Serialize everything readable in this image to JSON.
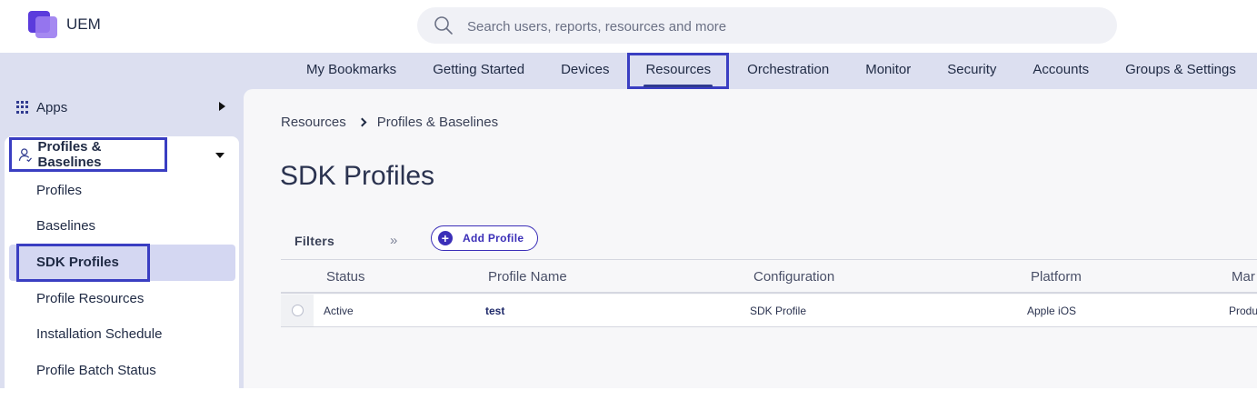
{
  "app": {
    "name": "UEM",
    "logo_icon": "uem-logo-icon",
    "brand_color": "#5b3bdc"
  },
  "search": {
    "placeholder": "Search users, reports, resources and more"
  },
  "topnav": {
    "items": [
      "My Bookmarks",
      "Getting Started",
      "Devices",
      "Resources",
      "Orchestration",
      "Monitor",
      "Security",
      "Accounts",
      "Groups & Settings"
    ],
    "active": "Resources"
  },
  "sidebar": {
    "apps_label": "Apps",
    "group_label": "Profiles & Baselines",
    "items": [
      "Profiles",
      "Baselines",
      "SDK Profiles",
      "Profile Resources",
      "Installation Schedule",
      "Profile Batch Status"
    ],
    "active": "SDK Profiles"
  },
  "breadcrumb": {
    "parent": "Resources",
    "current": "Profiles & Baselines"
  },
  "page": {
    "title": "SDK Profiles"
  },
  "toolbar": {
    "filters_label": "Filters",
    "add_button": "Add Profile"
  },
  "table": {
    "columns": [
      "Status",
      "Profile Name",
      "Configuration",
      "Platform",
      "Mar"
    ],
    "rows": [
      {
        "status": "Active",
        "name": "test",
        "configuration": "SDK Profile",
        "platform": "Apple iOS",
        "managed": "Produ"
      }
    ]
  }
}
